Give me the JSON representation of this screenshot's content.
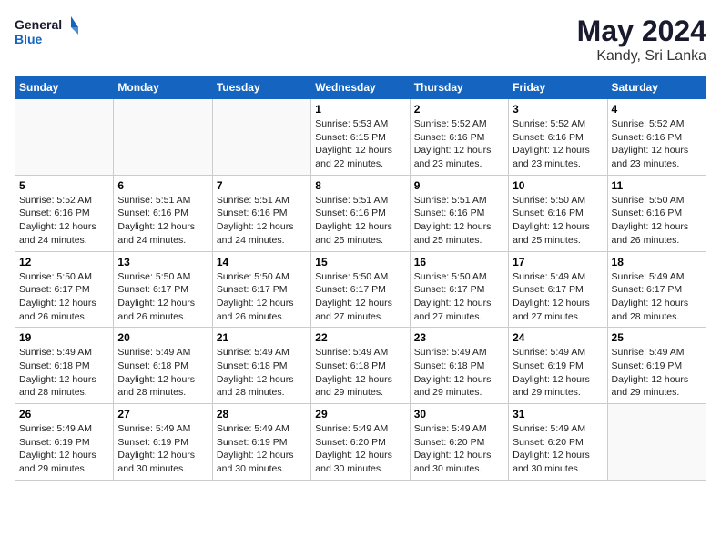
{
  "logo": {
    "line1": "General",
    "line2": "Blue"
  },
  "title": "May 2024",
  "subtitle": "Kandy, Sri Lanka",
  "days_header": [
    "Sunday",
    "Monday",
    "Tuesday",
    "Wednesday",
    "Thursday",
    "Friday",
    "Saturday"
  ],
  "weeks": [
    [
      {
        "day": "",
        "info": ""
      },
      {
        "day": "",
        "info": ""
      },
      {
        "day": "",
        "info": ""
      },
      {
        "day": "1",
        "info": "Sunrise: 5:53 AM\nSunset: 6:15 PM\nDaylight: 12 hours\nand 22 minutes."
      },
      {
        "day": "2",
        "info": "Sunrise: 5:52 AM\nSunset: 6:16 PM\nDaylight: 12 hours\nand 23 minutes."
      },
      {
        "day": "3",
        "info": "Sunrise: 5:52 AM\nSunset: 6:16 PM\nDaylight: 12 hours\nand 23 minutes."
      },
      {
        "day": "4",
        "info": "Sunrise: 5:52 AM\nSunset: 6:16 PM\nDaylight: 12 hours\nand 23 minutes."
      }
    ],
    [
      {
        "day": "5",
        "info": "Sunrise: 5:52 AM\nSunset: 6:16 PM\nDaylight: 12 hours\nand 24 minutes."
      },
      {
        "day": "6",
        "info": "Sunrise: 5:51 AM\nSunset: 6:16 PM\nDaylight: 12 hours\nand 24 minutes."
      },
      {
        "day": "7",
        "info": "Sunrise: 5:51 AM\nSunset: 6:16 PM\nDaylight: 12 hours\nand 24 minutes."
      },
      {
        "day": "8",
        "info": "Sunrise: 5:51 AM\nSunset: 6:16 PM\nDaylight: 12 hours\nand 25 minutes."
      },
      {
        "day": "9",
        "info": "Sunrise: 5:51 AM\nSunset: 6:16 PM\nDaylight: 12 hours\nand 25 minutes."
      },
      {
        "day": "10",
        "info": "Sunrise: 5:50 AM\nSunset: 6:16 PM\nDaylight: 12 hours\nand 25 minutes."
      },
      {
        "day": "11",
        "info": "Sunrise: 5:50 AM\nSunset: 6:16 PM\nDaylight: 12 hours\nand 26 minutes."
      }
    ],
    [
      {
        "day": "12",
        "info": "Sunrise: 5:50 AM\nSunset: 6:17 PM\nDaylight: 12 hours\nand 26 minutes."
      },
      {
        "day": "13",
        "info": "Sunrise: 5:50 AM\nSunset: 6:17 PM\nDaylight: 12 hours\nand 26 minutes."
      },
      {
        "day": "14",
        "info": "Sunrise: 5:50 AM\nSunset: 6:17 PM\nDaylight: 12 hours\nand 26 minutes."
      },
      {
        "day": "15",
        "info": "Sunrise: 5:50 AM\nSunset: 6:17 PM\nDaylight: 12 hours\nand 27 minutes."
      },
      {
        "day": "16",
        "info": "Sunrise: 5:50 AM\nSunset: 6:17 PM\nDaylight: 12 hours\nand 27 minutes."
      },
      {
        "day": "17",
        "info": "Sunrise: 5:49 AM\nSunset: 6:17 PM\nDaylight: 12 hours\nand 27 minutes."
      },
      {
        "day": "18",
        "info": "Sunrise: 5:49 AM\nSunset: 6:17 PM\nDaylight: 12 hours\nand 28 minutes."
      }
    ],
    [
      {
        "day": "19",
        "info": "Sunrise: 5:49 AM\nSunset: 6:18 PM\nDaylight: 12 hours\nand 28 minutes."
      },
      {
        "day": "20",
        "info": "Sunrise: 5:49 AM\nSunset: 6:18 PM\nDaylight: 12 hours\nand 28 minutes."
      },
      {
        "day": "21",
        "info": "Sunrise: 5:49 AM\nSunset: 6:18 PM\nDaylight: 12 hours\nand 28 minutes."
      },
      {
        "day": "22",
        "info": "Sunrise: 5:49 AM\nSunset: 6:18 PM\nDaylight: 12 hours\nand 29 minutes."
      },
      {
        "day": "23",
        "info": "Sunrise: 5:49 AM\nSunset: 6:18 PM\nDaylight: 12 hours\nand 29 minutes."
      },
      {
        "day": "24",
        "info": "Sunrise: 5:49 AM\nSunset: 6:19 PM\nDaylight: 12 hours\nand 29 minutes."
      },
      {
        "day": "25",
        "info": "Sunrise: 5:49 AM\nSunset: 6:19 PM\nDaylight: 12 hours\nand 29 minutes."
      }
    ],
    [
      {
        "day": "26",
        "info": "Sunrise: 5:49 AM\nSunset: 6:19 PM\nDaylight: 12 hours\nand 29 minutes."
      },
      {
        "day": "27",
        "info": "Sunrise: 5:49 AM\nSunset: 6:19 PM\nDaylight: 12 hours\nand 30 minutes."
      },
      {
        "day": "28",
        "info": "Sunrise: 5:49 AM\nSunset: 6:19 PM\nDaylight: 12 hours\nand 30 minutes."
      },
      {
        "day": "29",
        "info": "Sunrise: 5:49 AM\nSunset: 6:20 PM\nDaylight: 12 hours\nand 30 minutes."
      },
      {
        "day": "30",
        "info": "Sunrise: 5:49 AM\nSunset: 6:20 PM\nDaylight: 12 hours\nand 30 minutes."
      },
      {
        "day": "31",
        "info": "Sunrise: 5:49 AM\nSunset: 6:20 PM\nDaylight: 12 hours\nand 30 minutes."
      },
      {
        "day": "",
        "info": ""
      }
    ]
  ]
}
